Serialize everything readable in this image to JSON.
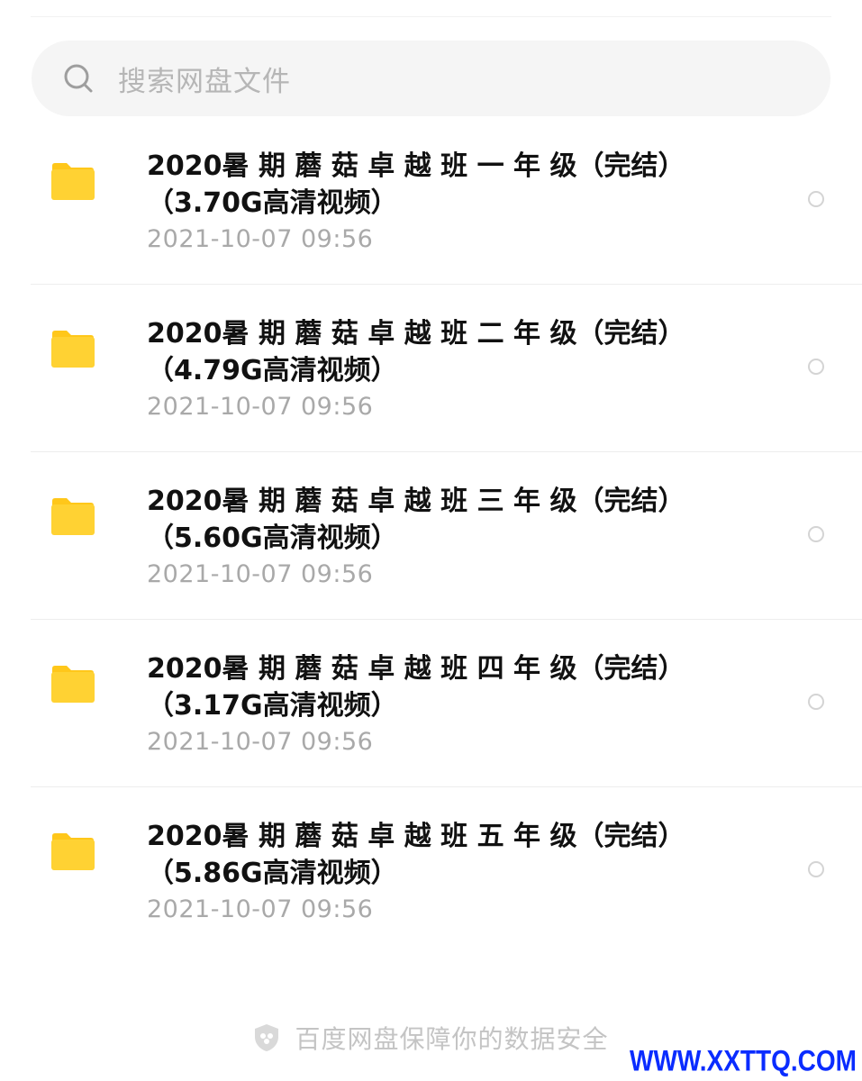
{
  "search": {
    "placeholder": "搜索网盘文件"
  },
  "files": [
    {
      "name": "2020暑 期 蘑 菇 卓 越 班 一 年 级（完结）（3.70G高清视频）",
      "date": "2021-10-07  09:56",
      "selected": false
    },
    {
      "name": "2020暑 期 蘑 菇 卓 越 班 二 年 级（完结）（4.79G高清视频）",
      "date": "2021-10-07  09:56",
      "selected": false
    },
    {
      "name": "2020暑 期 蘑 菇 卓 越 班 三 年 级（完结）（5.60G高清视频）",
      "date": "2021-10-07  09:56",
      "selected": false
    },
    {
      "name": "2020暑 期 蘑 菇 卓 越 班 四 年 级（完结）（3.17G高清视频）",
      "date": "2021-10-07  09:56",
      "selected": false
    },
    {
      "name": "2020暑 期 蘑 菇 卓 越 班 五 年 级（完结）（5.86G高清视频）",
      "date": "2021-10-07  09:56",
      "selected": false
    }
  ],
  "footer": {
    "text": "百度网盘保障你的数据安全"
  },
  "watermark": {
    "text": "WWW.XXTTQ.COM"
  },
  "colors": {
    "folder": "#ffd233",
    "folder_tab": "#ffc71a",
    "watermark": "#0a2cff"
  },
  "icons": {
    "search": "search-icon",
    "folder": "folder-icon",
    "radio": "radio-circle-icon",
    "shield": "shield-icon"
  }
}
